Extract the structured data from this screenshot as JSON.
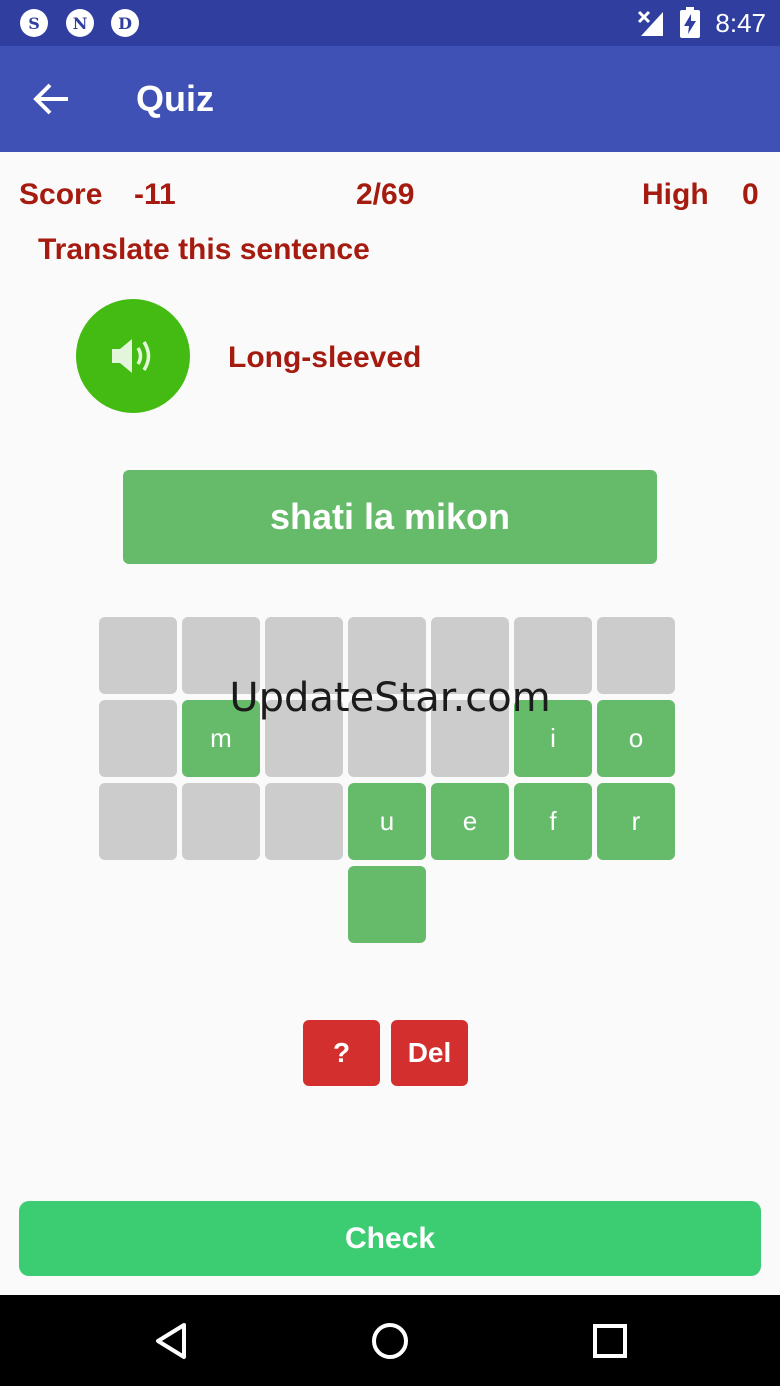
{
  "status_bar": {
    "notification_icons": [
      {
        "letter": "S",
        "icon": "s-app-icon"
      },
      {
        "letter": "N",
        "icon": "n-app-icon"
      },
      {
        "letter": "D",
        "icon": "d-app-icon"
      }
    ],
    "time": "8:47"
  },
  "toolbar": {
    "back_icon": "arrow-back-icon",
    "title": "Quiz"
  },
  "scoreboard": {
    "score_label": "Score",
    "score_value": "-11",
    "progress": "2/69",
    "high_label": "High",
    "high_value": "0"
  },
  "instruction": "Translate this sentence",
  "prompt": {
    "speaker_icon": "speaker-icon",
    "word": "Long-sleeved"
  },
  "answer": "shati la mikon",
  "letter_tiles": [
    [
      "",
      "",
      "",
      "",
      "",
      "",
      ""
    ],
    [
      "",
      "m",
      "",
      "",
      "",
      "i",
      "o"
    ],
    [
      "",
      "",
      "",
      "u",
      "e",
      "f",
      "r"
    ],
    [
      "",
      "",
      "",
      " ",
      "",
      "",
      ""
    ]
  ],
  "watermark": "UpdateStar.com",
  "buttons": {
    "hint": "?",
    "delete": "Del",
    "check": "Check"
  },
  "colors": {
    "status_bar": "#303f9f",
    "toolbar": "#3f51b5",
    "text_red": "#a61b0f",
    "speaker_green": "#44bb12",
    "tile_green": "#66bb6a",
    "tile_gray": "#cccccc",
    "action_red": "#d32f2f",
    "check_green": "#3ccd72"
  }
}
